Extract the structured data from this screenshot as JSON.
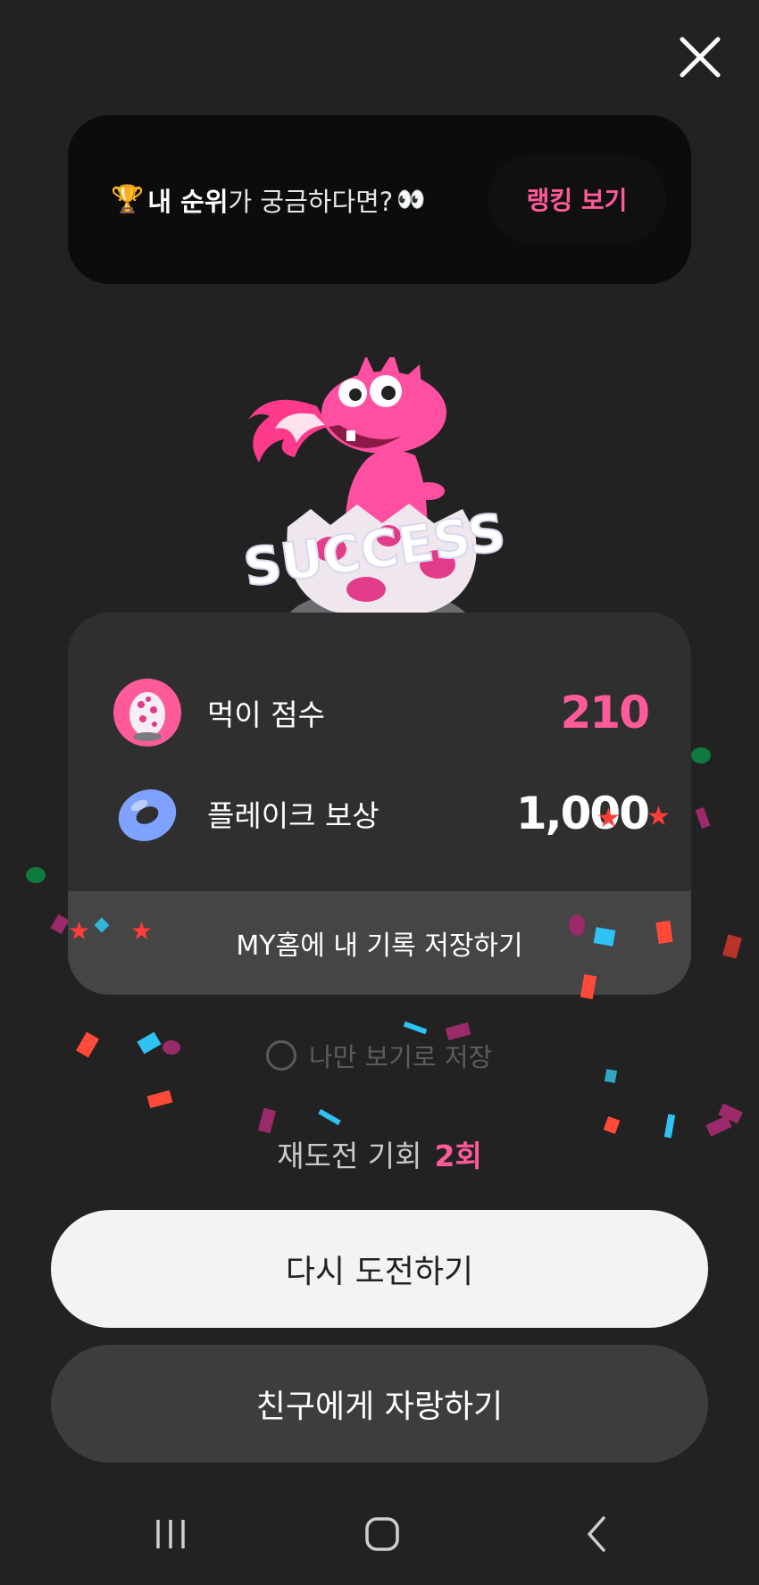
{
  "header": {
    "close_icon": "close-icon"
  },
  "rank_banner": {
    "trophy": "🏆",
    "highlight": "내 순위",
    "rest": "가 궁금하다면?",
    "eyes": "👀",
    "button_label": "랭킹 보기"
  },
  "mascot": {
    "success_text": "SUCCESS"
  },
  "results": {
    "score": {
      "label": "먹이 점수",
      "value": "210",
      "icon": "egg-icon"
    },
    "reward": {
      "label": "플레이크 보상",
      "value": "1,000",
      "icon": "donut-icon"
    },
    "save_record_label": "MY홈에 내 기록 저장하기"
  },
  "private_save": {
    "label": "나만 보기로 저장",
    "checked": false
  },
  "retry": {
    "label": "재도전 기회",
    "count": "2회"
  },
  "buttons": {
    "retry": "다시 도전하기",
    "share": "친구에게 자랑하기"
  },
  "colors": {
    "background": "#222222",
    "accent": "#ff5a99",
    "card": "#2f2f2f"
  }
}
